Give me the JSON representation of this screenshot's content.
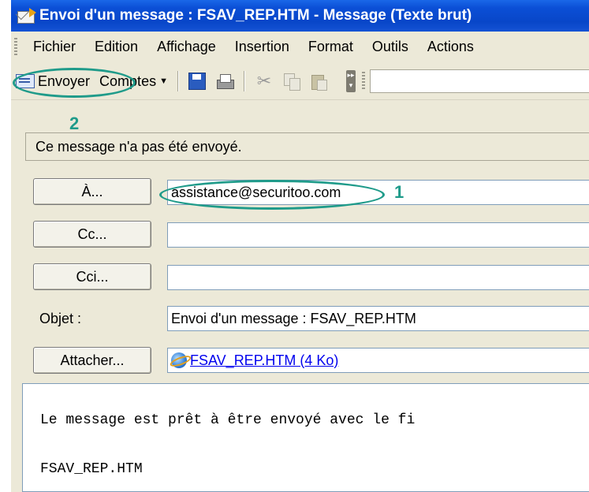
{
  "window": {
    "title": "Envoi d'un message : FSAV_REP.HTM - Message (Texte brut)"
  },
  "menubar": {
    "items": [
      {
        "label": "Fichier"
      },
      {
        "label": "Edition"
      },
      {
        "label": "Affichage"
      },
      {
        "label": "Insertion"
      },
      {
        "label": "Format"
      },
      {
        "label": "Outils"
      },
      {
        "label": "Actions"
      }
    ]
  },
  "toolbar": {
    "send_label": "Envoyer",
    "accounts_label": "Comptes",
    "icons": [
      "save-icon",
      "print-icon",
      "cut-icon",
      "copy-icon",
      "paste-icon"
    ]
  },
  "infobar": {
    "text": "Ce message n'a pas été envoyé."
  },
  "header": {
    "to_button": "À...",
    "to_value": "assistance@securitoo.com",
    "cc_button": "Cc...",
    "cc_value": "",
    "bcc_button": "Cci...",
    "bcc_value": "",
    "subject_label": "Objet :",
    "subject_value": "Envoi d'un message : FSAV_REP.HTM",
    "attach_button": "Attacher...",
    "attachment": "FSAV_REP.HTM (4 Ko)"
  },
  "body": {
    "line1": "Le message est prêt à être envoyé avec le fi",
    "line2": "FSAV_REP.HTM"
  },
  "annotations": {
    "step1": "1",
    "step2": "2",
    "color": "#1f9b8a"
  }
}
